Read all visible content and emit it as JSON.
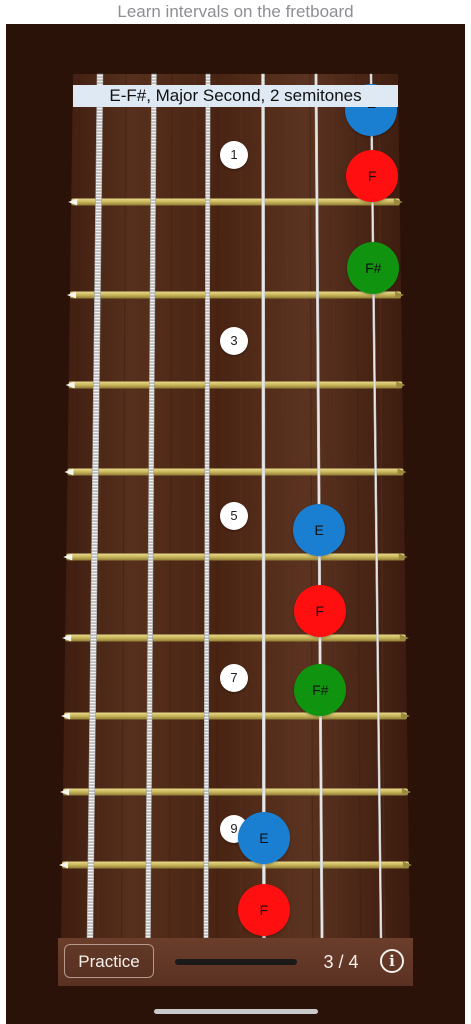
{
  "header": {
    "caption": "Learn intervals on the fretboard"
  },
  "interval": {
    "title": "E-F#, Major Second, 2 semitones"
  },
  "colors": {
    "E": "#1a7fd1",
    "F": "#ff0f0f",
    "F#": "#10940f",
    "fret": "#c9b55a",
    "wood": "#4a2413"
  },
  "fret_markers": [
    "1",
    "3",
    "5",
    "7",
    "9"
  ],
  "notes": [
    {
      "name": "E",
      "string": 2,
      "fret": 0
    },
    {
      "name": "F",
      "string": 2,
      "fret": 1
    },
    {
      "name": "F#",
      "string": 2,
      "fret": 2
    },
    {
      "name": "E",
      "string": 3,
      "fret": 5
    },
    {
      "name": "F",
      "string": 3,
      "fret": 6
    },
    {
      "name": "F#",
      "string": 3,
      "fret": 7
    },
    {
      "name": "E",
      "string": 4,
      "fret": 9
    },
    {
      "name": "F",
      "string": 4,
      "fret": 10
    }
  ],
  "toolbar": {
    "practice_label": "Practice",
    "counter": "3 / 4",
    "info_label": "i"
  }
}
